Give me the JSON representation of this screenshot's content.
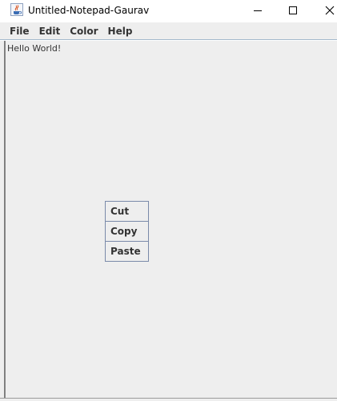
{
  "window": {
    "title": "Untitled-Notepad-Gaurav",
    "app_icon": "java-cup-icon",
    "controls": {
      "minimize_icon": "minimize-icon",
      "maximize_icon": "maximize-icon",
      "close_icon": "close-icon"
    }
  },
  "menubar": {
    "items": [
      {
        "label": "File"
      },
      {
        "label": "Edit"
      },
      {
        "label": "Color"
      },
      {
        "label": "Help"
      }
    ]
  },
  "editor": {
    "text": "Hello World!"
  },
  "context_menu": {
    "items": [
      {
        "label": "Cut"
      },
      {
        "label": "Copy"
      },
      {
        "label": "Paste"
      }
    ]
  },
  "colors": {
    "background": "#eeeeee",
    "menu_border": "#7a8aa9",
    "text": "#333333"
  }
}
